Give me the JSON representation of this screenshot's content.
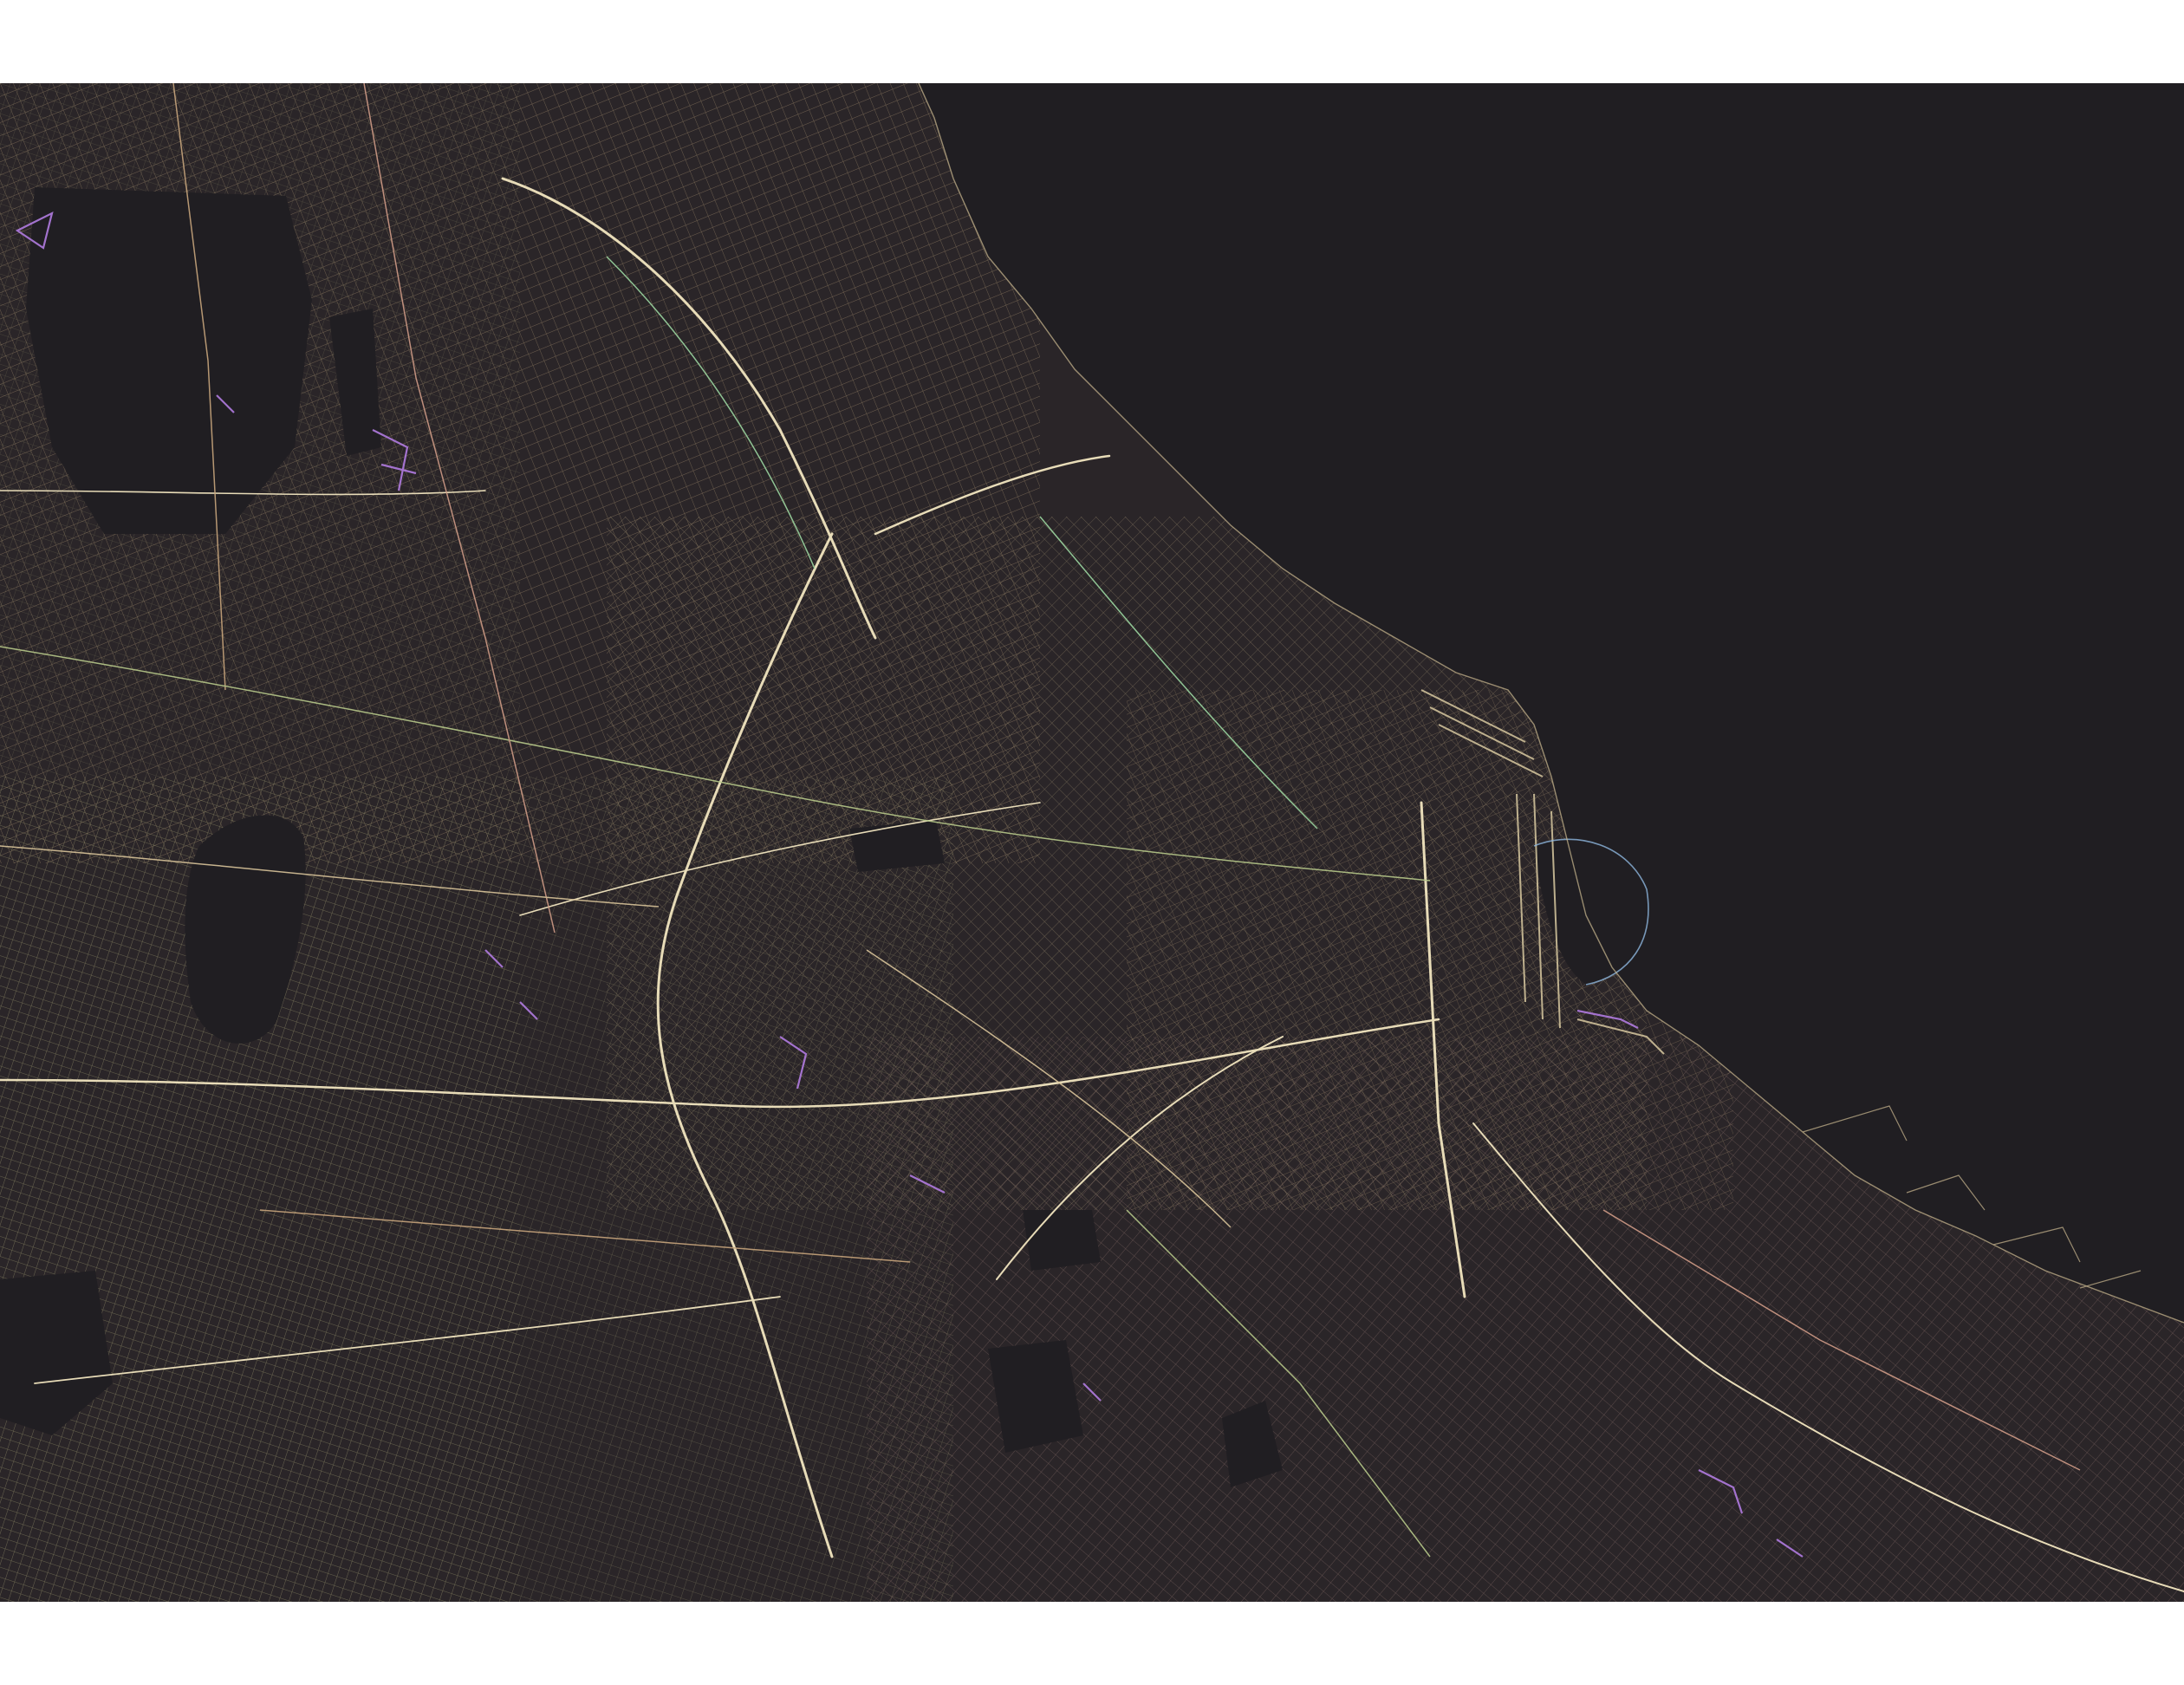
{
  "map": {
    "style": "dark street-network poster",
    "colors": {
      "page_background": "#ffffff",
      "water": "#201e22",
      "land": "#2a2528",
      "street_palette": [
        "#d9c49a",
        "#c8a57c",
        "#b7c98a",
        "#e7d8b0",
        "#cf9b86",
        "#b48fd1",
        "#9bd6a0",
        "#d46fd6",
        "#8fb8e0"
      ],
      "highway": "#e8dcb8",
      "accent_purple": "#b07be0"
    },
    "features": [
      "coastline",
      "river-estuary",
      "port-docks",
      "street-grid",
      "avenues",
      "highways",
      "railways",
      "parks"
    ]
  }
}
